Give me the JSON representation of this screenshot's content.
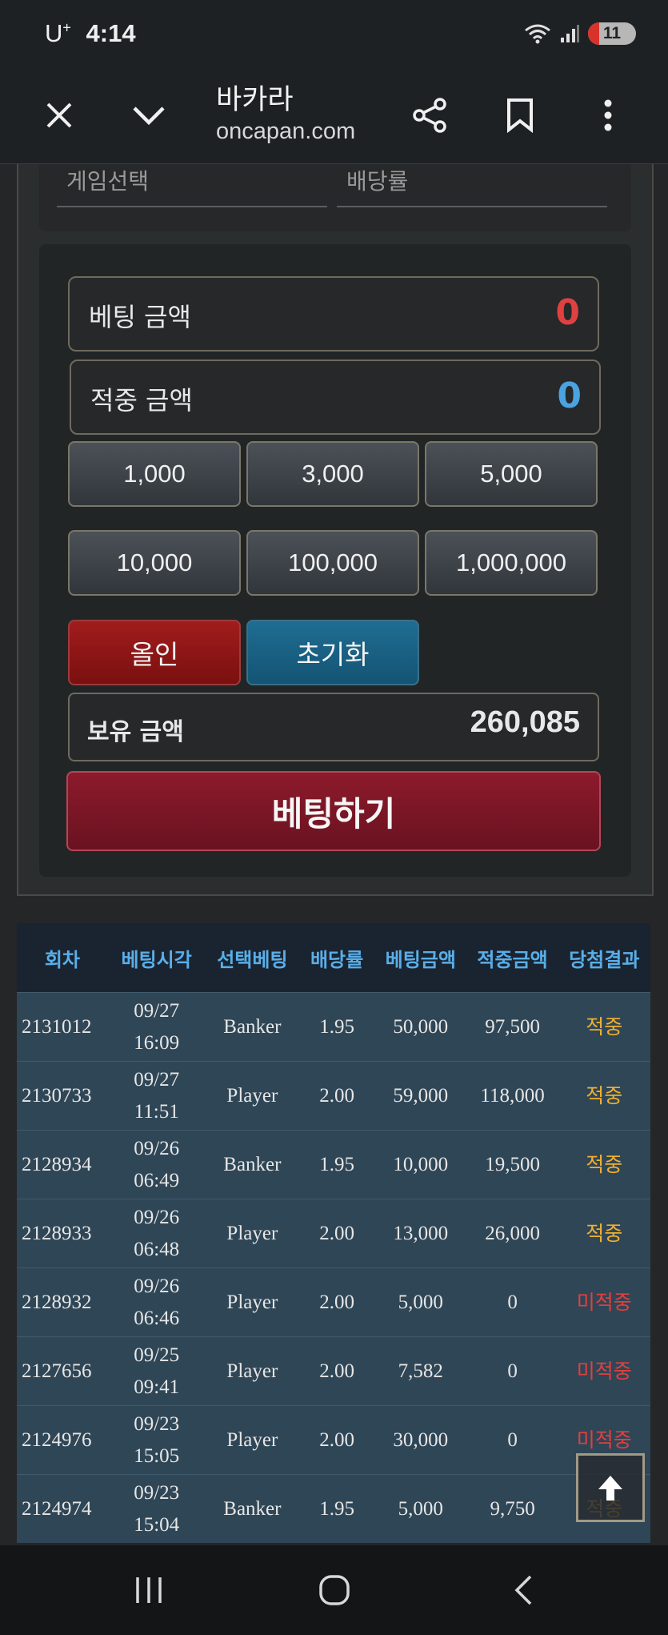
{
  "status": {
    "carrier": "U",
    "carrier_sup": "+",
    "time": "4:14",
    "battery": "11"
  },
  "browser": {
    "title": "바카라",
    "url": "oncapan.com"
  },
  "selection": {
    "game_label": "게임선택",
    "odds_label": "배당률"
  },
  "betting": {
    "bet_amount_label": "베팅 금액",
    "bet_amount_value": "0",
    "win_amount_label": "적중 금액",
    "win_amount_value": "0",
    "chips": [
      "1,000",
      "3,000",
      "5,000",
      "10,000",
      "100,000",
      "1,000,000"
    ],
    "allin_label": "올인",
    "reset_label": "초기화",
    "balance_label": "보유 금액",
    "balance_value": "260,085",
    "bet_button_label": "베팅하기",
    "colors": {
      "bet_value": "#e04040",
      "win_value": "#4aa3e0"
    }
  },
  "history": {
    "headers": [
      "회차",
      "베팅시각",
      "선택베팅",
      "배당률",
      "베팅금액",
      "적중금액",
      "당첨결과"
    ],
    "rows": [
      {
        "round": "2131012",
        "date": "09/27",
        "time": "16:09",
        "pick": "Banker",
        "odds": "1.95",
        "bet": "50,000",
        "win": "97,500",
        "result": "적중"
      },
      {
        "round": "2130733",
        "date": "09/27",
        "time": "11:51",
        "pick": "Player",
        "odds": "2.00",
        "bet": "59,000",
        "win": "118,000",
        "result": "적중"
      },
      {
        "round": "2128934",
        "date": "09/26",
        "time": "06:49",
        "pick": "Banker",
        "odds": "1.95",
        "bet": "10,000",
        "win": "19,500",
        "result": "적중"
      },
      {
        "round": "2128933",
        "date": "09/26",
        "time": "06:48",
        "pick": "Player",
        "odds": "2.00",
        "bet": "13,000",
        "win": "26,000",
        "result": "적중"
      },
      {
        "round": "2128932",
        "date": "09/26",
        "time": "06:46",
        "pick": "Player",
        "odds": "2.00",
        "bet": "5,000",
        "win": "0",
        "result": "미적중"
      },
      {
        "round": "2127656",
        "date": "09/25",
        "time": "09:41",
        "pick": "Player",
        "odds": "2.00",
        "bet": "7,582",
        "win": "0",
        "result": "미적중"
      },
      {
        "round": "2124976",
        "date": "09/23",
        "time": "15:05",
        "pick": "Player",
        "odds": "2.00",
        "bet": "30,000",
        "win": "0",
        "result": "미적중"
      },
      {
        "round": "2124974",
        "date": "09/23",
        "time": "15:04",
        "pick": "Banker",
        "odds": "1.95",
        "bet": "5,000",
        "win": "9,750",
        "result": "적중"
      }
    ]
  },
  "icons": {
    "close": "close-icon",
    "chevron": "chevron-down-icon",
    "share": "share-icon",
    "bookmark": "bookmark-icon",
    "menu": "more-vert-icon",
    "scroll_top": "arrow-up-icon"
  }
}
